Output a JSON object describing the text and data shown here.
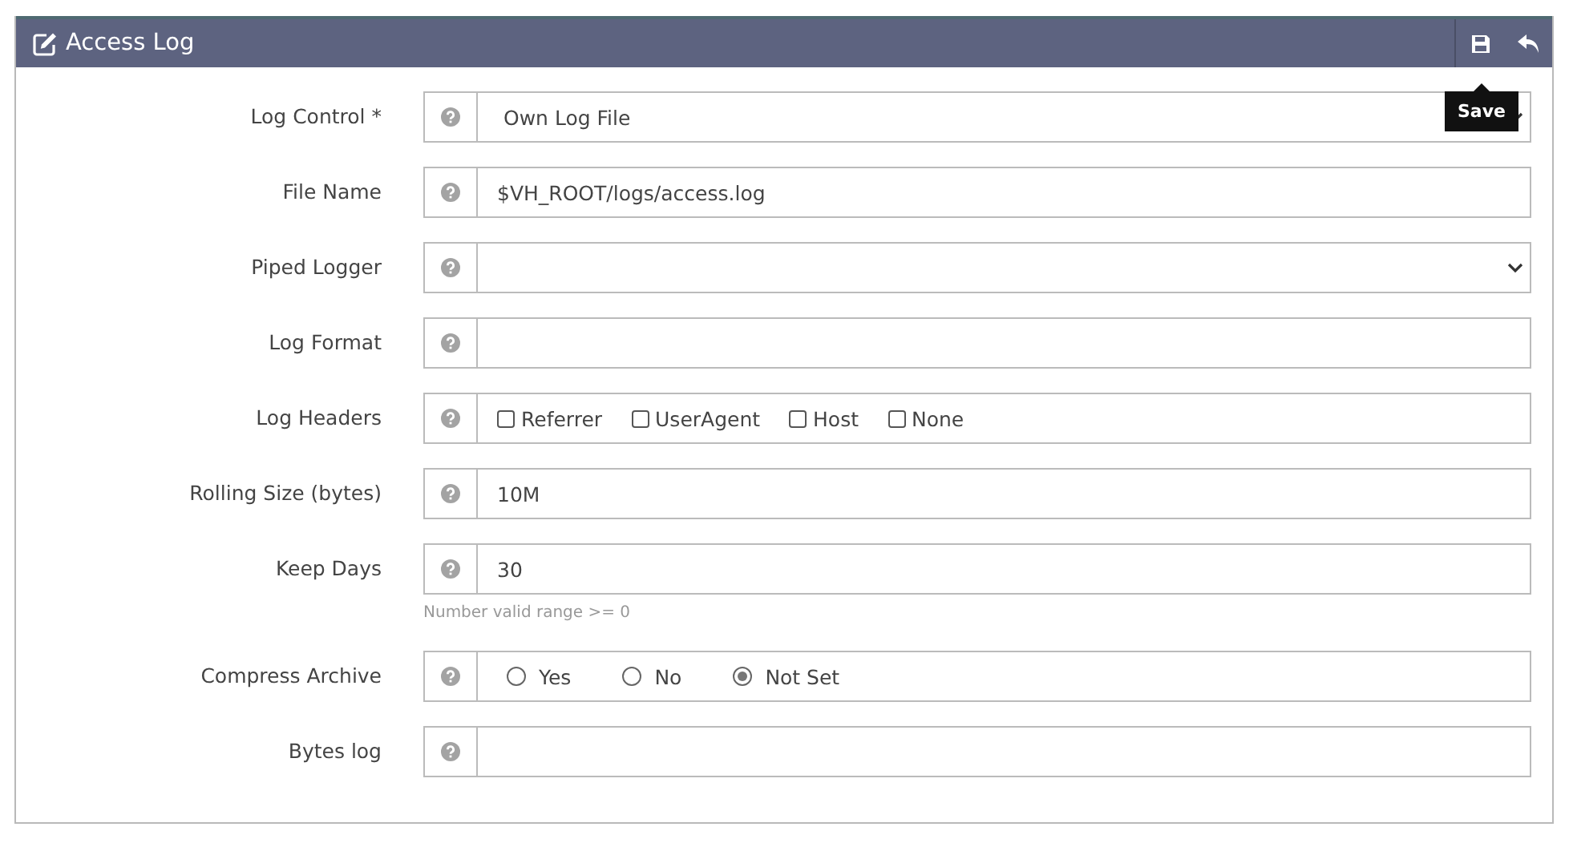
{
  "panel": {
    "title": "Access Log",
    "tooltip": "Save"
  },
  "rows": [
    {
      "label": "Log Control *",
      "kind": "select",
      "value": "Own Log File"
    },
    {
      "label": "File Name",
      "kind": "text",
      "value": "$VH_ROOT/logs/access.log"
    },
    {
      "label": "Piped Logger",
      "kind": "select"
    },
    {
      "label": "Log Format",
      "kind": "text"
    },
    {
      "label": "Log Headers",
      "kind": "checkboxes",
      "options": [
        {
          "label": "Referrer",
          "checked": false
        },
        {
          "label": "UserAgent",
          "checked": false
        },
        {
          "label": "Host",
          "checked": false
        },
        {
          "label": "None",
          "checked": false
        }
      ]
    },
    {
      "label": "Rolling Size (bytes)",
      "kind": "text",
      "value": "10M"
    },
    {
      "label": "Keep Days",
      "kind": "text",
      "value": "30",
      "hint": "Number valid range >= 0"
    },
    {
      "label": "Compress Archive",
      "kind": "radios",
      "options": [
        {
          "label": "Yes",
          "selected": false
        },
        {
          "label": "No",
          "selected": false
        },
        {
          "label": "Not Set",
          "selected": true
        }
      ]
    },
    {
      "label": "Bytes log",
      "kind": "text"
    }
  ]
}
